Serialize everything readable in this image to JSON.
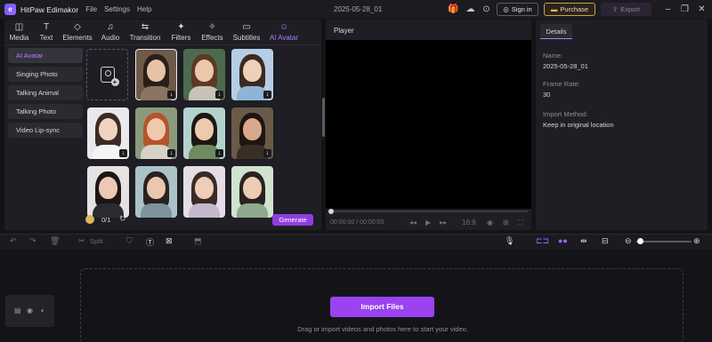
{
  "titlebar": {
    "app_name": "HitPaw Edimakor",
    "menus": [
      "File",
      "Settings",
      "Help"
    ],
    "project_title": "2025-05-28_01",
    "sign_in": "Sign in",
    "purchase": "Purchase",
    "export": "Export"
  },
  "tabs": [
    {
      "label": "Media",
      "icon": "media-icon"
    },
    {
      "label": "Text",
      "icon": "text-icon"
    },
    {
      "label": "Elements",
      "icon": "elements-icon"
    },
    {
      "label": "Audio",
      "icon": "audio-icon"
    },
    {
      "label": "Transition",
      "icon": "transition-icon"
    },
    {
      "label": "Filters",
      "icon": "filters-icon"
    },
    {
      "label": "Effects",
      "icon": "effects-icon"
    },
    {
      "label": "Subtitles",
      "icon": "subtitles-icon"
    },
    {
      "label": "AI Avatar",
      "icon": "ai-avatar-icon",
      "active": true
    }
  ],
  "sidebar": {
    "items": [
      "AI Avatar",
      "Singing Photo",
      "Talking Animal",
      "Talking Photo",
      "Video Lip-sync"
    ],
    "active_index": 0
  },
  "avatar_panel": {
    "credits": "0/1",
    "generate": "Generate"
  },
  "player": {
    "title": "Player",
    "timecode": "00:00:00 / 00:00:00",
    "aspect": "16:9"
  },
  "details": {
    "tab": "Details",
    "name_label": "Name:",
    "name_value": "2025-05-28_01",
    "frame_rate_label": "Frame Rate:",
    "frame_rate_value": "30",
    "import_method_label": "Import Method:",
    "import_method_value": "Keep in original location"
  },
  "toolbar": {
    "split": "Split"
  },
  "timeline": {
    "import_button": "Import Files",
    "drop_hint": "Drag or import videos and photos here to start your video."
  },
  "colors": {
    "accent": "#b47cff",
    "generate": "#8f3fe0",
    "import": "#9a43ef",
    "purchase_border": "#c9a14a"
  }
}
